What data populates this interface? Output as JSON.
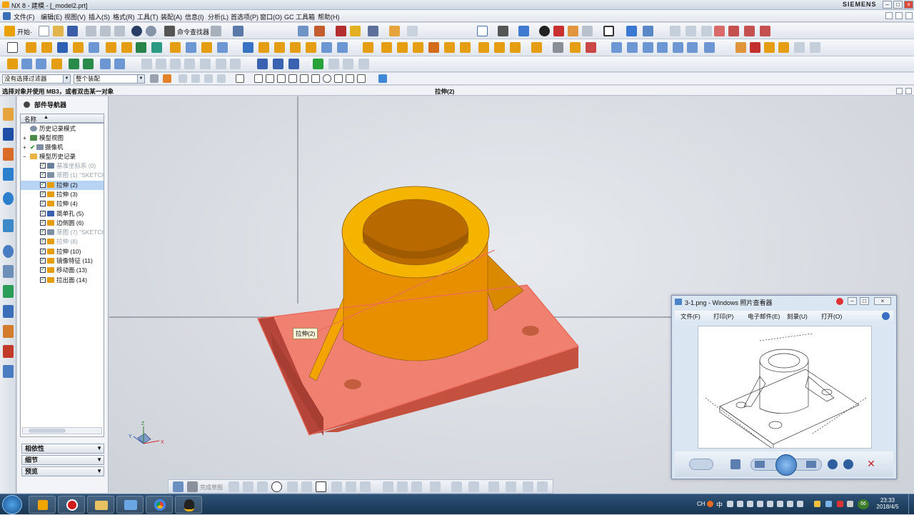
{
  "window": {
    "title": "NX 8 - 建模 - [_model2.prt]",
    "brand": "SIEMENS"
  },
  "menu": [
    "文件(F)",
    "编辑(E)",
    "视图(V)",
    "插入(S)",
    "格式(R)",
    "工具(T)",
    "装配(A)",
    "信息(I)",
    "分析(L)",
    "首选项(P)",
    "窗口(O)",
    "GC 工具箱",
    "帮助(H)"
  ],
  "toolbar": {
    "start_label": "开始·",
    "command_finder_label": "命令查找器"
  },
  "filter": {
    "type_filter": "没有选择过滤器",
    "scope": "整个装配"
  },
  "status": {
    "prompt": "选择对象并使用 MB3，或者双击某一对象",
    "feature": "拉伸(2)"
  },
  "navigator": {
    "title": "部件导航器",
    "column_header": "名称",
    "top_items": [
      "历史记录模式",
      "模型视图",
      "摄像机",
      "模型历史记录"
    ],
    "features": [
      {
        "label": "基准坐标系 (0)",
        "state": "grey"
      },
      {
        "label": "草图 (1) \"SKETCH_",
        "state": "grey"
      },
      {
        "label": "拉伸 (2)",
        "state": "selected"
      },
      {
        "label": "拉伸 (3)",
        "state": "normal"
      },
      {
        "label": "拉伸 (4)",
        "state": "normal"
      },
      {
        "label": "简单孔 (5)",
        "state": "normal"
      },
      {
        "label": "边倒圆 (6)",
        "state": "normal"
      },
      {
        "label": "草图 (7) \"SKETCH_",
        "state": "grey"
      },
      {
        "label": "拉伸 (8)",
        "state": "grey"
      },
      {
        "label": "拉伸 (10)",
        "state": "normal"
      },
      {
        "label": "镜像特征 (11)",
        "state": "normal"
      },
      {
        "label": "移动面 (13)",
        "state": "normal"
      },
      {
        "label": "拉出面 (14)",
        "state": "normal"
      }
    ],
    "panels": [
      "相依性",
      "细节",
      "预览"
    ]
  },
  "viewport": {
    "tooltip": "拉伸(2)",
    "triad_labels": [
      "Y",
      "Z",
      "X"
    ]
  },
  "photo_viewer": {
    "title": "3-1.png - Windows 照片查看器",
    "menu": [
      "文件(F)",
      "打印(P)",
      "电子邮件(E)",
      "刻录(U)",
      "打开(O)"
    ]
  },
  "sketch_toolbar": {
    "finish_label": "完成草图"
  },
  "taskbar": {
    "time": "23:33",
    "date": "2018/4/5",
    "ime": "CH",
    "ime_char": "中",
    "badge": "66"
  },
  "colors": {
    "model_orange": "#f0a000",
    "model_dark": "#c96a00",
    "highlight_red": "#f08070",
    "taskbar": "#1f3d5c"
  }
}
